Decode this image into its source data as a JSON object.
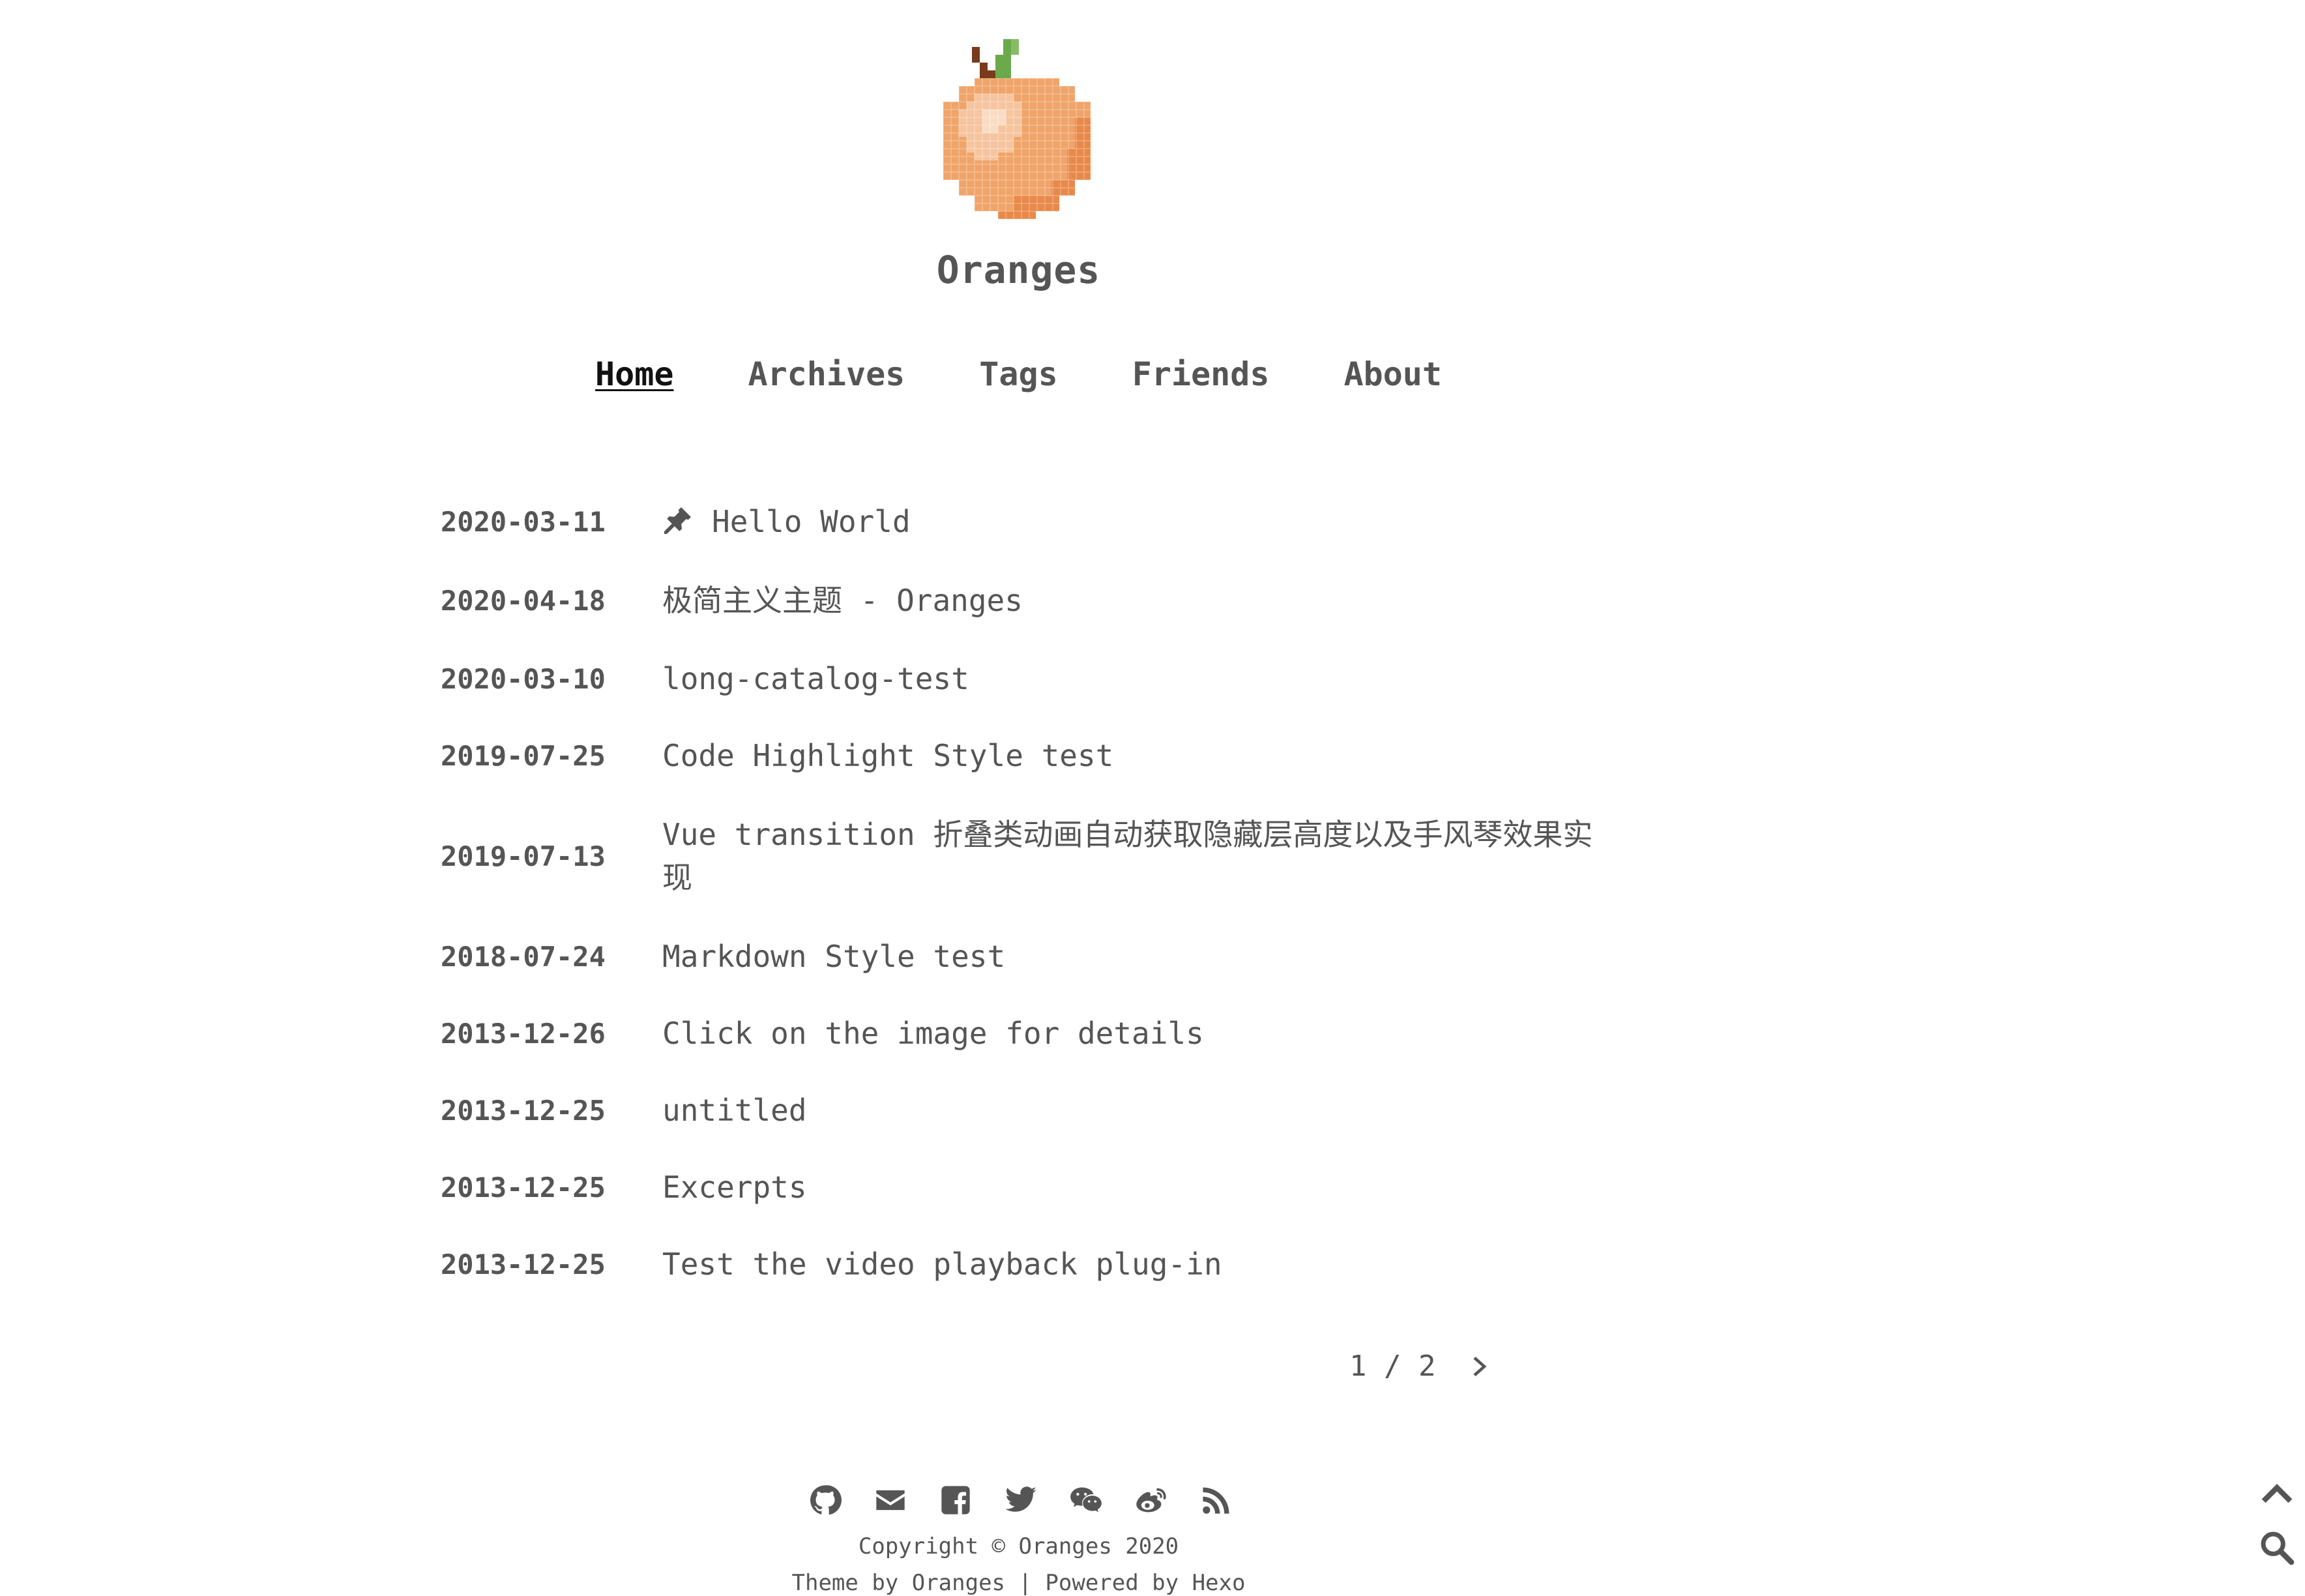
{
  "site": {
    "title": "Oranges"
  },
  "nav": {
    "items": [
      {
        "label": "Home",
        "active": true
      },
      {
        "label": "Archives",
        "active": false
      },
      {
        "label": "Tags",
        "active": false
      },
      {
        "label": "Friends",
        "active": false
      },
      {
        "label": "About",
        "active": false
      }
    ]
  },
  "posts": [
    {
      "date": "2020-03-11",
      "title": "Hello World",
      "pinned": true
    },
    {
      "date": "2020-04-18",
      "title": "极简主义主题 - Oranges",
      "pinned": false
    },
    {
      "date": "2020-03-10",
      "title": "long-catalog-test",
      "pinned": false
    },
    {
      "date": "2019-07-25",
      "title": "Code Highlight Style test",
      "pinned": false
    },
    {
      "date": "2019-07-13",
      "title": "Vue transition 折叠类动画自动获取隐藏层高度以及手风琴效果实现",
      "pinned": false
    },
    {
      "date": "2018-07-24",
      "title": "Markdown Style test",
      "pinned": false
    },
    {
      "date": "2013-12-26",
      "title": "Click on the image for details",
      "pinned": false
    },
    {
      "date": "2013-12-25",
      "title": "untitled",
      "pinned": false
    },
    {
      "date": "2013-12-25",
      "title": "Excerpts",
      "pinned": false
    },
    {
      "date": "2013-12-25",
      "title": "Test the video playback plug-in",
      "pinned": false
    }
  ],
  "pagination": {
    "text": "1 / 2"
  },
  "footer": {
    "social_icons": [
      "github-icon",
      "email-icon",
      "facebook-icon",
      "twitter-icon",
      "wechat-icon",
      "weibo-icon",
      "rss-icon"
    ],
    "copyright": "Copyright © Oranges 2020",
    "credits": "Theme by Oranges | Powered by Hexo"
  },
  "colors": {
    "text": "#555555",
    "active": "#111111",
    "highlight": "#bdbdbd",
    "orange": "#f0a469"
  }
}
